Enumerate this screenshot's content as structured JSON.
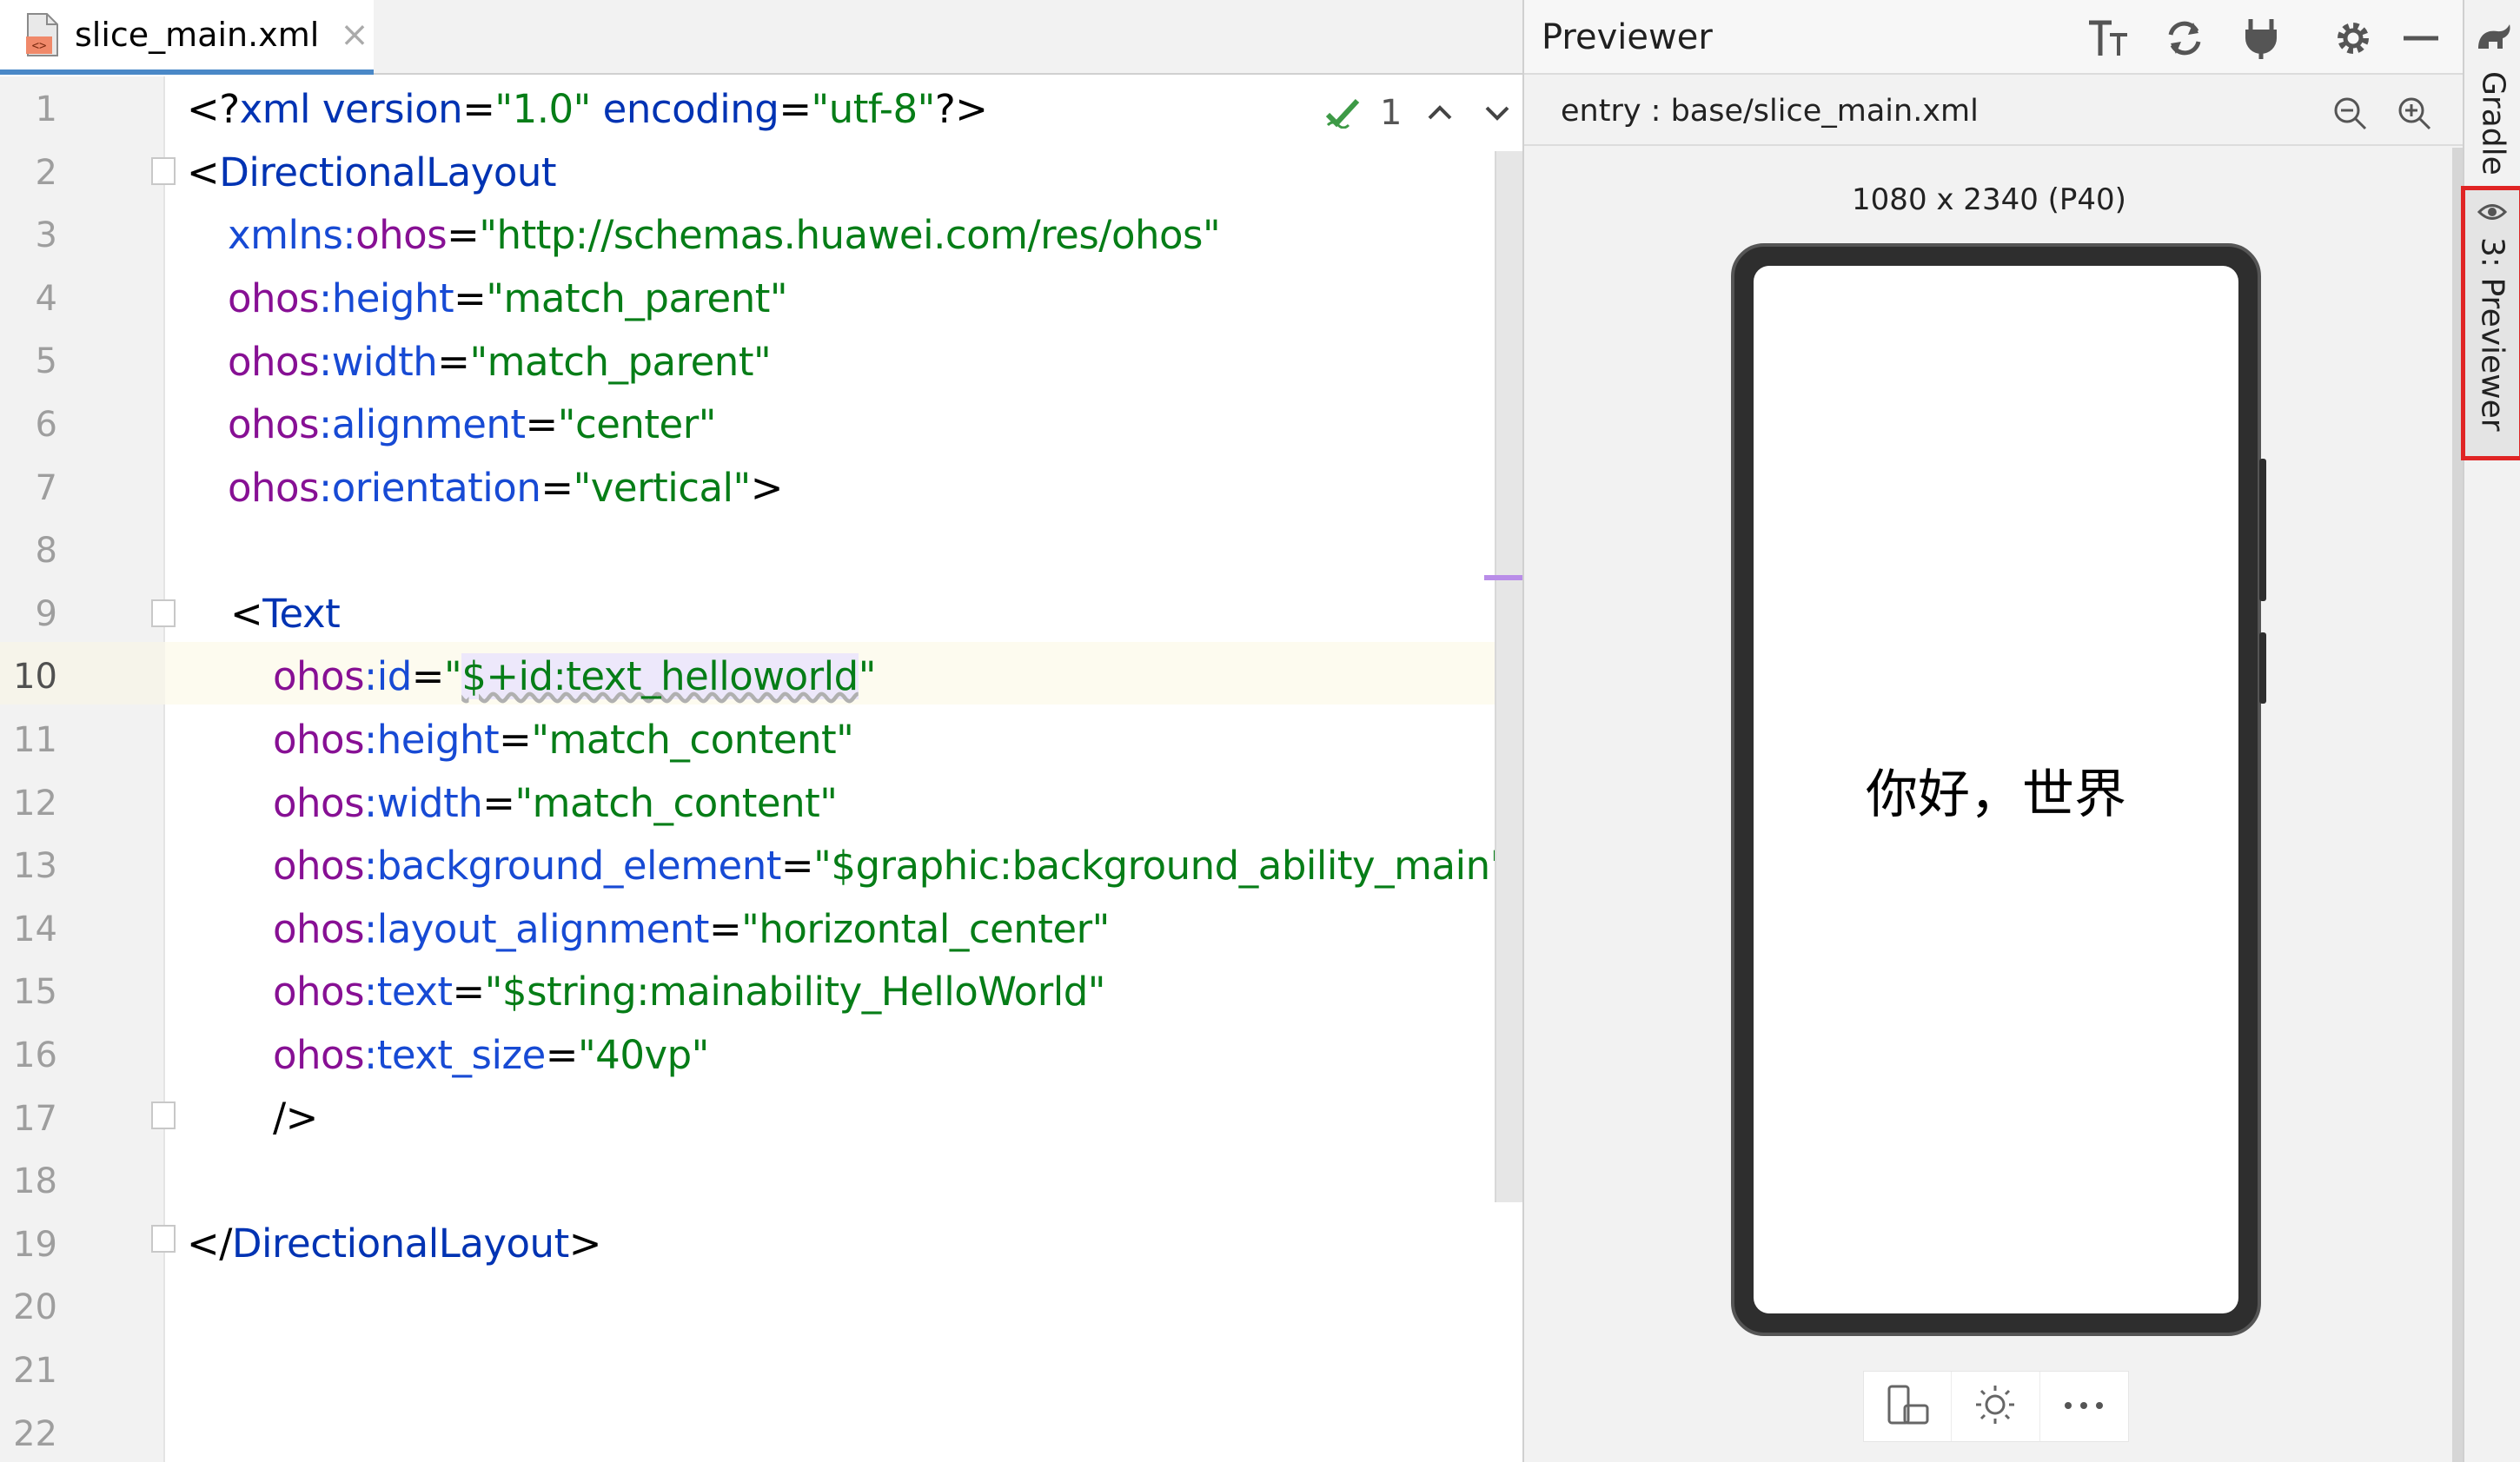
{
  "editor": {
    "tab_label": "slice_main.xml",
    "tab_close": "×",
    "inspection_count": "1",
    "line_numbers": [
      "1",
      "2",
      "3",
      "4",
      "5",
      "6",
      "7",
      "8",
      "9",
      "10",
      "11",
      "12",
      "13",
      "14",
      "15",
      "16",
      "17",
      "18",
      "19",
      "20",
      "21",
      "22"
    ],
    "current_line": "10",
    "code": {
      "l1": {
        "a": "<?",
        "b": "xml version",
        "c": "=",
        "d": "\"1.0\"",
        "e": " encoding",
        "f": "=",
        "g": "\"utf-8\"",
        "h": "?>"
      },
      "l2": {
        "a": "<",
        "b": "DirectionalLayout"
      },
      "l3": {
        "a": "xmlns:",
        "b": "ohos",
        "c": "=",
        "d": "\"http://schemas.huawei.com/res/ohos\""
      },
      "l4": {
        "a": "ohos",
        "b": ":height",
        "c": "=",
        "d": "\"match_parent\""
      },
      "l5": {
        "a": "ohos",
        "b": ":width",
        "c": "=",
        "d": "\"match_parent\""
      },
      "l6": {
        "a": "ohos",
        "b": ":alignment",
        "c": "=",
        "d": "\"center\""
      },
      "l7": {
        "a": "ohos",
        "b": ":orientation",
        "c": "=",
        "d": "\"vertical\"",
        "e": ">"
      },
      "l9": {
        "a": "<",
        "b": "Text"
      },
      "l10": {
        "a": "ohos",
        "b": ":id",
        "c": "=",
        "d": "\"",
        "e": "$+id:text_helloworld",
        "f": "\""
      },
      "l11": {
        "a": "ohos",
        "b": ":height",
        "c": "=",
        "d": "\"match_content\""
      },
      "l12": {
        "a": "ohos",
        "b": ":width",
        "c": "=",
        "d": "\"match_content\""
      },
      "l13": {
        "a": "ohos",
        "b": ":background_element",
        "c": "=",
        "d": "\"$graphic:background_ability_main\""
      },
      "l14": {
        "a": "ohos",
        "b": ":layout_alignment",
        "c": "=",
        "d": "\"horizontal_center\""
      },
      "l15": {
        "a": "ohos",
        "b": ":text",
        "c": "=",
        "d": "\"$string:mainability_HelloWorld\""
      },
      "l16": {
        "a": "ohos",
        "b": ":text_size",
        "c": "=",
        "d": "\"40vp\""
      },
      "l17": {
        "a": "/>"
      },
      "l19": {
        "a": "</",
        "b": "DirectionalLayout",
        "c": ">"
      }
    }
  },
  "previewer": {
    "title": "Previewer",
    "entry": "entry : base/slice_main.xml",
    "device_label": "1080 x 2340 (P40)",
    "screen_text": "你好，世界"
  },
  "tool_strip": {
    "gradle_label": "Gradle",
    "previewer_label": "3: Previewer"
  },
  "colors": {
    "tag": "#0033b3",
    "attribute_namespace": "#871094",
    "attribute": "#174ad4",
    "value": "#067d17",
    "active_tab_underline": "#4a88c7",
    "highlight_box": "#e02424"
  }
}
